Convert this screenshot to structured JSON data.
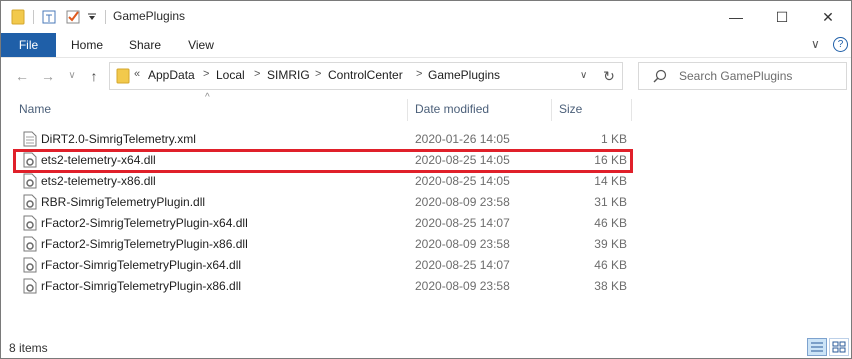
{
  "window": {
    "title": "GamePlugins",
    "minimize_label": "—",
    "maximize_label": "☐",
    "close_label": "✕",
    "help_label": "?"
  },
  "ribbon": {
    "tabs": [
      "File",
      "Home",
      "Share",
      "View"
    ],
    "expand_label": "∨"
  },
  "nav": {
    "back": "←",
    "forward": "→",
    "recent": "∨",
    "up": "↑",
    "overflow": "«",
    "refresh": "↻",
    "dropdown": "∨"
  },
  "breadcrumb": [
    "AppData",
    "Local",
    "SIMRIG",
    "ControlCenter",
    "GamePlugins"
  ],
  "search": {
    "placeholder": "Search GamePlugins"
  },
  "columns": {
    "name": "Name",
    "date": "Date modified",
    "size": "Size"
  },
  "files": [
    {
      "name": "DiRT2.0-SimrigTelemetry.xml",
      "date": "2020-01-26 14:05",
      "size": "1 KB",
      "type": "xml"
    },
    {
      "name": "ets2-telemetry-x64.dll",
      "date": "2020-08-25 14:05",
      "size": "16 KB",
      "type": "dll"
    },
    {
      "name": "ets2-telemetry-x86.dll",
      "date": "2020-08-25 14:05",
      "size": "14 KB",
      "type": "dll"
    },
    {
      "name": "RBR-SimrigTelemetryPlugin.dll",
      "date": "2020-08-09 23:58",
      "size": "31 KB",
      "type": "dll"
    },
    {
      "name": "rFactor2-SimrigTelemetryPlugin-x64.dll",
      "date": "2020-08-25 14:07",
      "size": "46 KB",
      "type": "dll"
    },
    {
      "name": "rFactor2-SimrigTelemetryPlugin-x86.dll",
      "date": "2020-08-09 23:58",
      "size": "39 KB",
      "type": "dll"
    },
    {
      "name": "rFactor-SimrigTelemetryPlugin-x64.dll",
      "date": "2020-08-25 14:07",
      "size": "46 KB",
      "type": "dll"
    },
    {
      "name": "rFactor-SimrigTelemetryPlugin-x86.dll",
      "date": "2020-08-09 23:58",
      "size": "38 KB",
      "type": "dll"
    }
  ],
  "status": {
    "item_count": "8 items"
  },
  "colors": {
    "file_tab": "#1f5fa8",
    "highlight": "#e0202a",
    "folder": "#f2c94c"
  }
}
